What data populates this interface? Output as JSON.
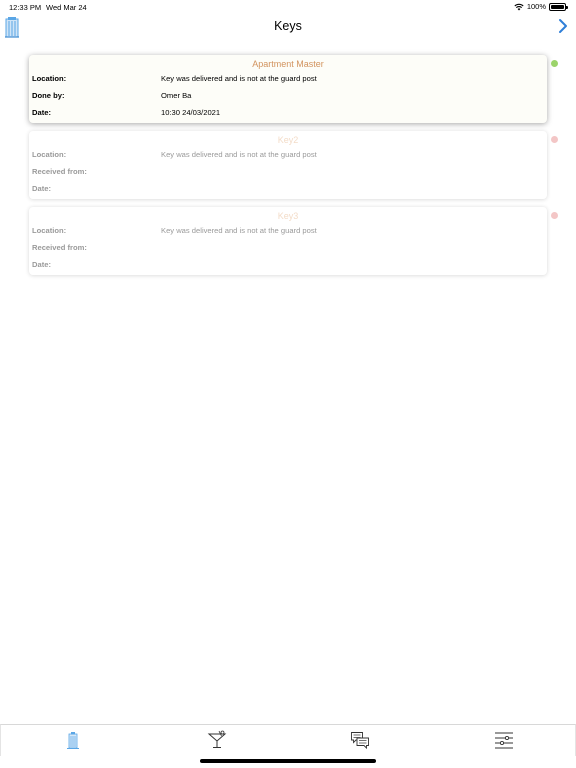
{
  "status_bar": {
    "time": "12:33 PM",
    "date": "Wed Mar 24",
    "battery": "100%",
    "icons": [
      "wifi-icon",
      "battery-icon"
    ]
  },
  "nav": {
    "title": "Keys",
    "left_icon": "building-icon",
    "right_icon": "chevron-right-icon"
  },
  "keys": [
    {
      "title": "Apartment Master",
      "rows": [
        {
          "label": "Location:",
          "value": "Key was delivered and is not at the guard post"
        },
        {
          "label": "Done by:",
          "value": "Omer Ba"
        },
        {
          "label": "Date:",
          "value": "10:30 24/03/2021"
        }
      ],
      "status_color": "#9bd36a"
    },
    {
      "title": "Key2",
      "rows": [
        {
          "label": "Location:",
          "value": "Key was delivered and is not at the guard post"
        },
        {
          "label": "Received from:",
          "value": ""
        },
        {
          "label": "Date:",
          "value": ""
        }
      ],
      "status_color": "#f3c6c6"
    },
    {
      "title": "Key3",
      "rows": [
        {
          "label": "Location:",
          "value": "Key was delivered and is not at the guard post"
        },
        {
          "label": "Received from:",
          "value": ""
        },
        {
          "label": "Date:",
          "value": ""
        }
      ],
      "status_color": "#f3c6c6"
    }
  ],
  "tabs": [
    {
      "icon": "building-icon",
      "active": true
    },
    {
      "icon": "cocktail-icon",
      "active": false
    },
    {
      "icon": "chat-bubbles-icon",
      "active": false
    },
    {
      "icon": "sliders-icon",
      "active": false
    }
  ],
  "colors": {
    "accent_blue": "#5aa6e6",
    "title_orange": "#d2935e",
    "title_orange_faded": "#f3dcc8"
  }
}
